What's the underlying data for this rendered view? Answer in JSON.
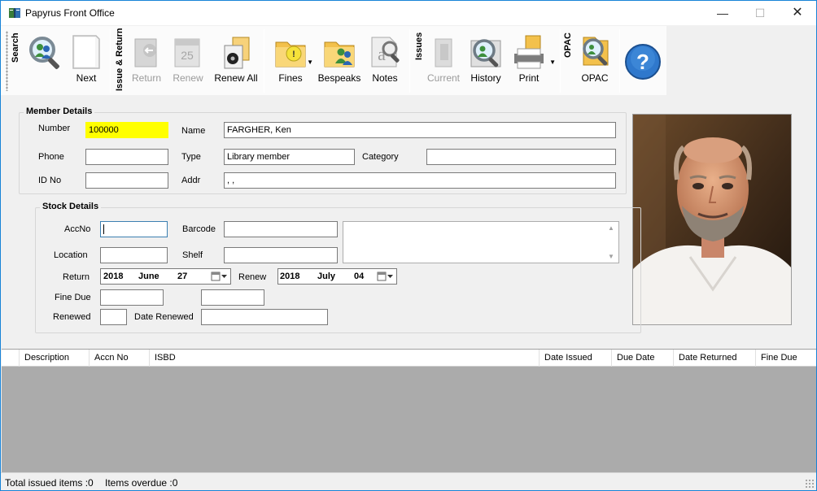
{
  "window": {
    "title": "Papyrus Front Office",
    "min_glyph": "—",
    "max_glyph": "☐",
    "close_glyph": "✕"
  },
  "toolbar": {
    "groups": {
      "search": "Search",
      "issue_return": "Issue & Return",
      "issues": "Issues",
      "opac": "OPAC"
    },
    "buttons": {
      "next": "Next",
      "return": "Return",
      "renew": "Renew",
      "renew_all": "Renew All",
      "fines": "Fines",
      "bespeaks": "Bespeaks",
      "notes": "Notes",
      "current": "Current",
      "history": "History",
      "print": "Print",
      "opac": "OPAC"
    },
    "calendar_day": "25",
    "icons": [
      "search-icon",
      "next-icon",
      "return-icon",
      "renew-calendar-icon",
      "renew-all-icon",
      "fines-icon",
      "bespeaks-icon",
      "notes-icon",
      "current-icon",
      "history-icon",
      "print-icon",
      "opac-icon",
      "help-icon"
    ]
  },
  "member": {
    "title": "Member Details",
    "labels": {
      "number": "Number",
      "name": "Name",
      "phone": "Phone",
      "type": "Type",
      "category": "Category",
      "id_no": "ID No",
      "addr": "Addr"
    },
    "values": {
      "number": "100000",
      "name": "FARGHER, Ken",
      "phone": "",
      "type": "Library member",
      "category": "",
      "id_no": "",
      "addr": ", ,"
    }
  },
  "stock": {
    "title": "Stock Details",
    "labels": {
      "accno": "AccNo",
      "barcode": "Barcode",
      "location": "Location",
      "shelf": "Shelf",
      "return": "Return",
      "renew": "Renew",
      "fine_due": "Fine Due",
      "renewed": "Renewed",
      "date_renewed": "Date Renewed"
    },
    "values": {
      "accno": "",
      "barcode": "",
      "location": "",
      "shelf": "",
      "fine_due": "",
      "fine_extra": "",
      "renewed": "",
      "date_renewed": ""
    },
    "return_date": {
      "year": "2018",
      "month": "June",
      "day": "27"
    },
    "renew_date": {
      "year": "2018",
      "month": "July",
      "day": "04"
    }
  },
  "grid": {
    "columns": [
      "",
      "Description",
      "Accn No",
      "ISBD",
      "Date Issued",
      "Due Date",
      "Date Returned",
      "Fine Due"
    ],
    "rows": []
  },
  "status": {
    "total_issued": "Total issued items :0",
    "overdue": "Items overdue :0"
  },
  "colors": {
    "highlight": "#ffff00",
    "grid_background": "#ababab",
    "window_border": "#1883d7"
  }
}
